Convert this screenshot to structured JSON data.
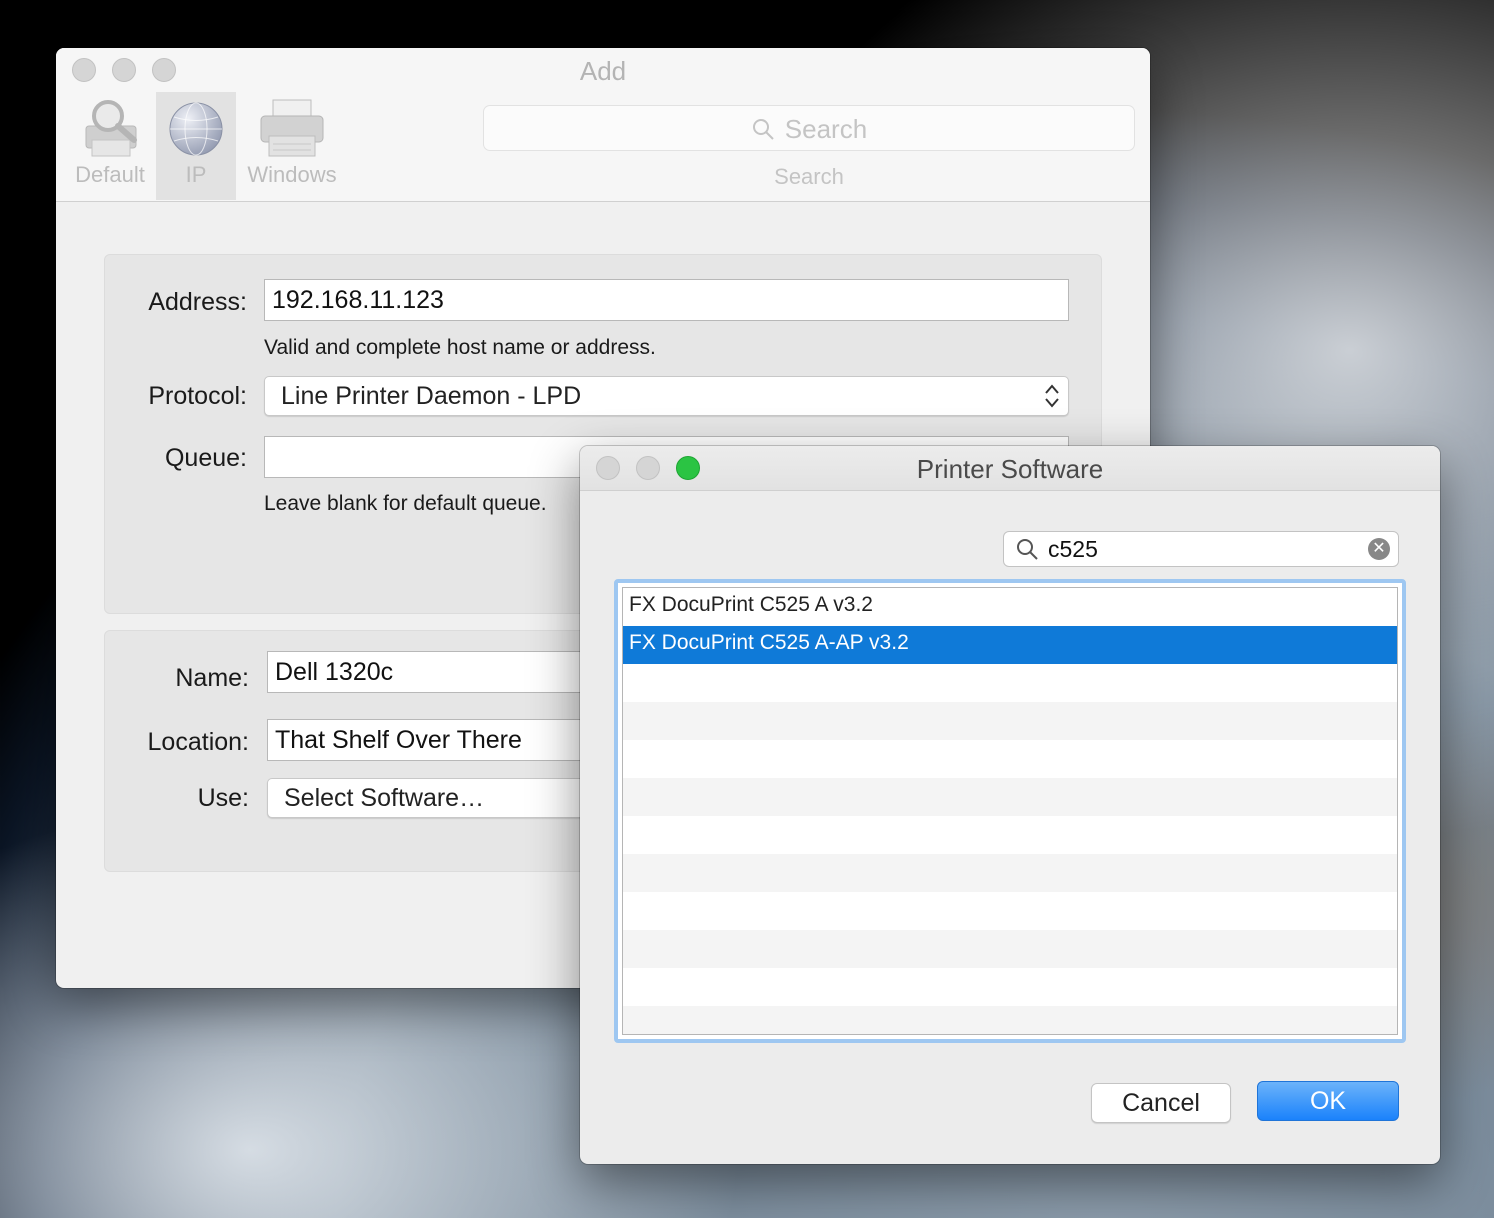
{
  "add_window": {
    "title": "Add",
    "toolbar": {
      "items": [
        {
          "label": "Default",
          "icon": "magnifier-printer-icon"
        },
        {
          "label": "IP",
          "icon": "globe-icon"
        },
        {
          "label": "Windows",
          "icon": "printer-icon"
        }
      ],
      "search_placeholder": "Search",
      "search_label": "Search"
    },
    "form": {
      "address_label": "Address:",
      "address_value": "192.168.11.123",
      "address_hint": "Valid and complete host name or address.",
      "protocol_label": "Protocol:",
      "protocol_value": "Line Printer Daemon - LPD",
      "queue_label": "Queue:",
      "queue_value": "",
      "queue_hint": "Leave blank for default queue.",
      "name_label": "Name:",
      "name_value": "Dell 1320c",
      "location_label": "Location:",
      "location_value": "That Shelf Over There",
      "use_label": "Use:",
      "use_value": "Select Software…"
    }
  },
  "printer_software": {
    "title": "Printer Software",
    "search_value": "c525",
    "items": [
      "FX DocuPrint C525 A v3.2",
      "FX DocuPrint C525 A-AP v3.2"
    ],
    "cancel_label": "Cancel",
    "ok_label": "OK"
  },
  "colors": {
    "selection": "#0f7ad8",
    "ok_button": "#1a82fb",
    "zoom_green": "#2bc443"
  }
}
